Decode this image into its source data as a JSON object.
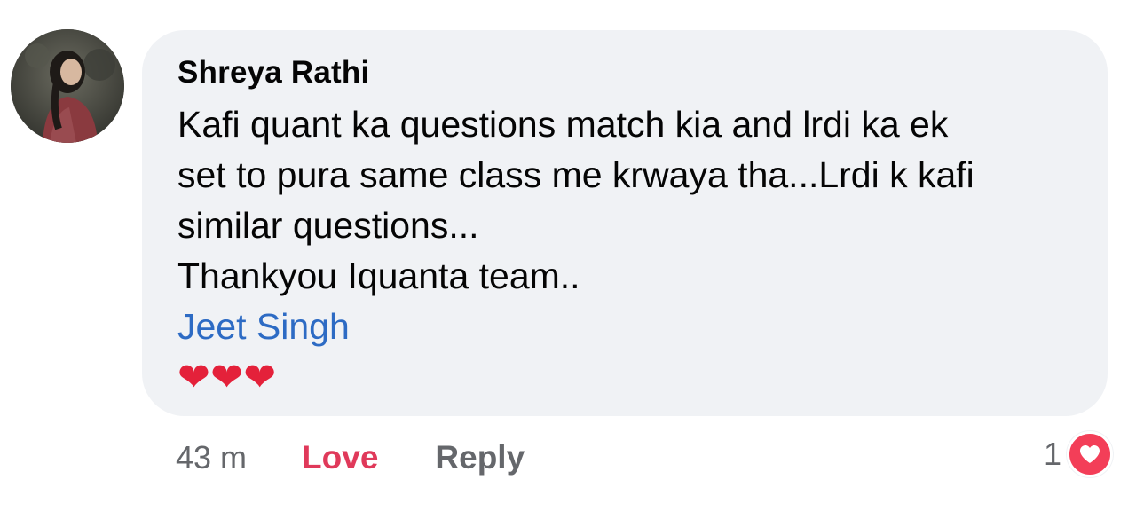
{
  "comment": {
    "author": "Shreya Rathi",
    "lines": [
      "Kafi quant ka questions match kia and lrdi ka ek",
      "set to pura same class me krwaya tha...Lrdi k kafi",
      "similar questions...",
      "Thankyou Iquanta team.."
    ],
    "mention": "Jeet Singh",
    "hearts": [
      "❤",
      "❤",
      "❤"
    ],
    "avatar_icon": "profile-photo"
  },
  "actions": {
    "time": "43 m",
    "love_label": "Love",
    "reply_label": "Reply"
  },
  "reactions": {
    "count": "1",
    "icon": "love-reaction-icon"
  },
  "colors": {
    "bubble_bg": "#f0f2f5",
    "text": "#050505",
    "muted": "#65676b",
    "mention": "#2d6bc4",
    "love": "#e0395a",
    "heart": "#f33e58"
  }
}
